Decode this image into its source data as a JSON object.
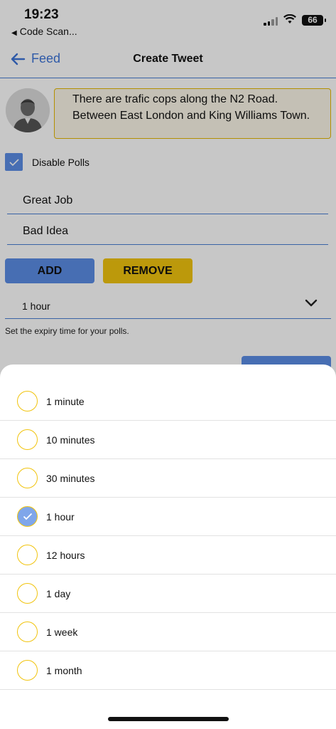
{
  "status_bar": {
    "time": "19:23",
    "back_app": "Code Scan...",
    "battery": "66"
  },
  "nav": {
    "back_label": "Feed",
    "title": "Create Tweet"
  },
  "tweet": {
    "text": "There are trafic cops along the N2 Road. Between East London and King Williams Town."
  },
  "polls": {
    "disable_label": "Disable Polls",
    "disabled_checked": true,
    "options": [
      "Great Job",
      "Bad Idea"
    ],
    "add_label": "ADD",
    "remove_label": "REMOVE",
    "expiry_value": "1 hour",
    "expiry_hint": "Set the expiry time for your polls."
  },
  "sheet": {
    "options": [
      "1 minute",
      "10 minutes",
      "30 minutes",
      "1 hour",
      "12 hours",
      "1 day",
      "1 week",
      "1 month"
    ],
    "selected": "1 hour"
  },
  "colors": {
    "accent_blue": "#5b8de6",
    "accent_yellow": "#f1c40f"
  }
}
